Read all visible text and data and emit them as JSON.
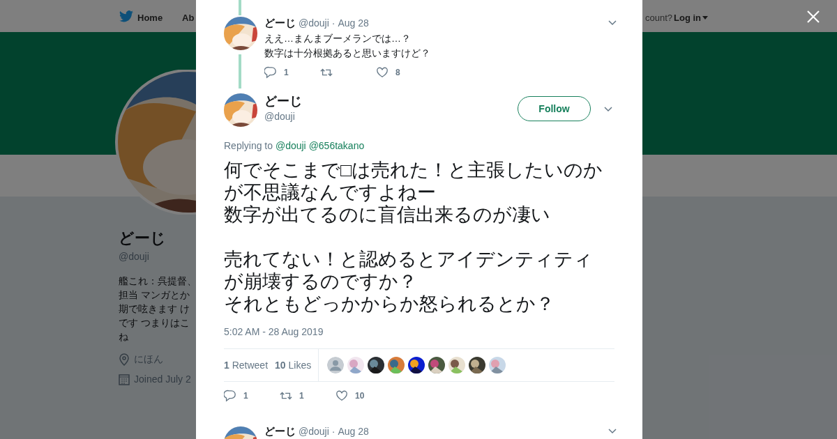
{
  "nav": {
    "home": "Home",
    "about": "Ab",
    "account_prompt": "count?",
    "login": "Log in"
  },
  "profile": {
    "name": "どーじ",
    "handle": "@douji",
    "bio": [
      "艦これ：呉提督、",
      "担当 マンガとか",
      "期で呟きます け",
      "です つまりはこ",
      "ね"
    ],
    "location": "にほん",
    "joined": "Joined July 2"
  },
  "parent_tweet": {
    "name": "どーじ",
    "handle": "@douji",
    "separator": "·",
    "date": "Aug 28",
    "lines": [
      "ええ…まんまブーメランでは…？",
      "数字は十分根拠あると思いますけど？"
    ],
    "actions": [
      {
        "kind": "reply",
        "count": "1"
      },
      {
        "kind": "retweet"
      },
      {
        "kind": "like",
        "count": "8"
      }
    ]
  },
  "main_tweet": {
    "name": "どーじ",
    "handle": "@douji",
    "follow": "Follow",
    "replying_prefix": "Replying to",
    "mentions": [
      "@douji",
      "@656takano"
    ],
    "paragraphs": [
      [
        "何でそこまで□は売れた！と主張したいのか",
        "が不思議なんですよねー",
        "数字が出てるのに盲信出来るのが凄い"
      ],
      [
        "売れてない！と認めるとアイデンティティ",
        "が崩壊するのですか？",
        "それともどっかからか怒られるとか？"
      ]
    ],
    "timestamp": "5:02 AM - 28 Aug 2019",
    "stats": [
      "**1** Retweet",
      "**10** Likes"
    ],
    "actions": [
      {
        "kind": "reply",
        "count": "1"
      },
      {
        "kind": "retweet",
        "count": "1"
      },
      {
        "kind": "like",
        "count": "10"
      }
    ]
  },
  "next_tweet": {
    "name": "どーじ",
    "handle": "@douji",
    "separator": "·",
    "date": "Aug 28"
  }
}
